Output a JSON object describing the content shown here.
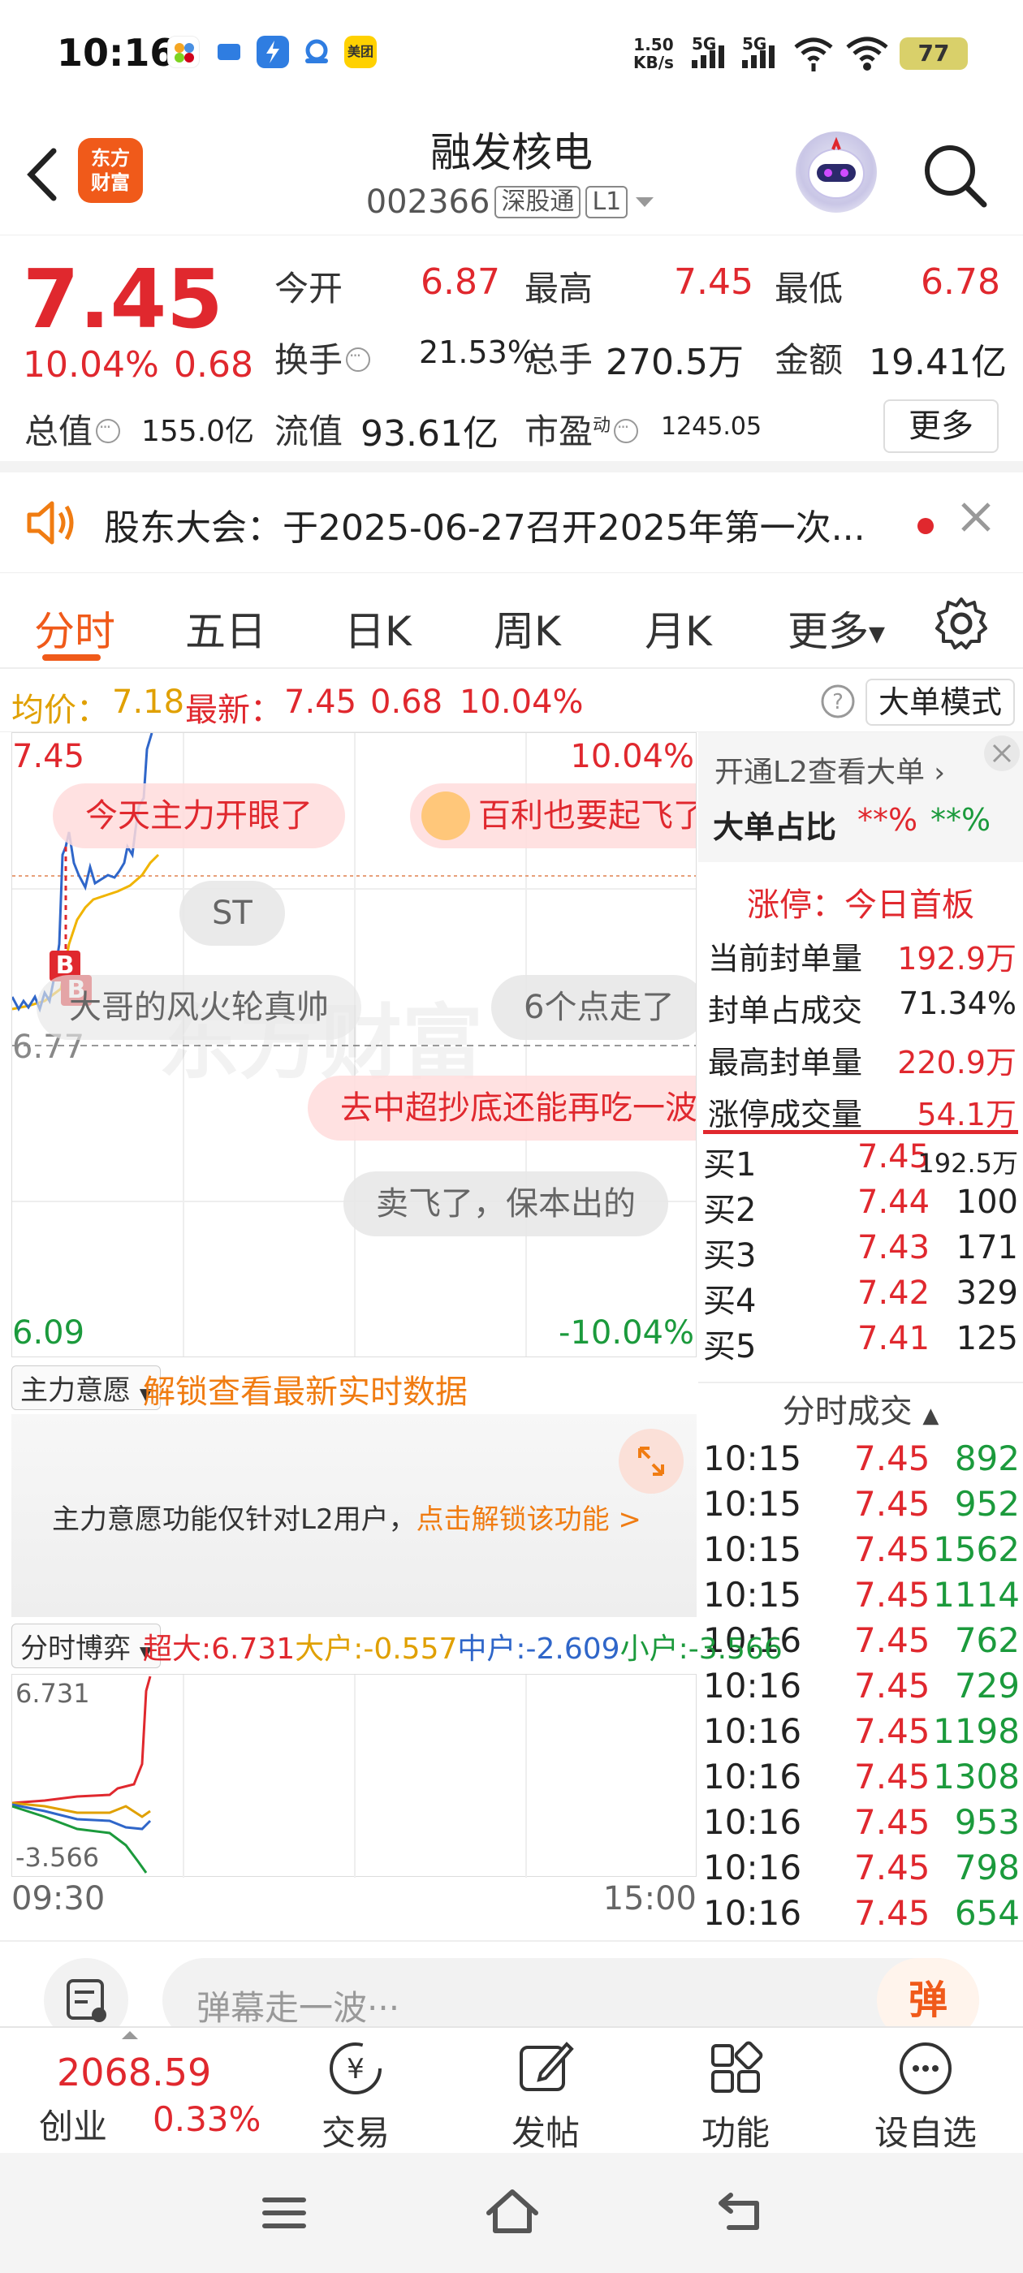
{
  "status_bar": {
    "time": "10:16",
    "net_speed_value": "1.50",
    "net_speed_unit": "KB/s",
    "sig1": "5G",
    "sig2": "5G",
    "battery": "77",
    "app_icons": [
      "wallet-app-icon",
      "messaging-app-icon",
      "flash-app-icon",
      "cloud-app-icon",
      "meituan-app-icon"
    ],
    "meituan_label": "美团"
  },
  "header": {
    "logo_line1": "东方",
    "logo_line2": "财富",
    "stock_name": "融发核电",
    "stock_code": "002366",
    "tag_sz": "深股通",
    "tag_level": "L1"
  },
  "quote": {
    "price": "7.45",
    "change_pct": "10.04%",
    "change_amt": "0.68",
    "open_label": "今开",
    "open": "6.87",
    "high_label": "最高",
    "high": "7.45",
    "low_label": "最低",
    "low": "6.78",
    "turnover_label": "换手",
    "turnover": "21.53%",
    "volume_label": "总手",
    "volume": "270.5万",
    "amount_label": "金额",
    "amount": "19.41亿",
    "mktcap_label": "总值",
    "mktcap": "155.0亿",
    "float_label": "流值",
    "float_cap": "93.61亿",
    "pe_label": "市盈",
    "pe_sup": "动",
    "pe": "1245.05",
    "more": "更多"
  },
  "notice": {
    "text": "股东大会：于2025-06-27召开2025年第一次..."
  },
  "tabs": [
    {
      "label": "分时",
      "active": true
    },
    {
      "label": "五日",
      "active": false
    },
    {
      "label": "日K",
      "active": false
    },
    {
      "label": "周K",
      "active": false
    },
    {
      "label": "月K",
      "active": false
    },
    {
      "label": "更多",
      "active": false
    }
  ],
  "avg_bar": {
    "avg_label": "均价：",
    "avg_value": "7.18",
    "latest_label": "最新：",
    "latest_value": "7.45",
    "latest_change": "0.68",
    "latest_pct": "10.04%",
    "mode_button": "大单模式"
  },
  "chart": {
    "top_price": "7.45",
    "top_pct": "10.04%",
    "mid_price": "6.77",
    "bottom_price": "6.09",
    "bottom_pct": "-10.04%",
    "marker_b1": "B",
    "marker_b2": "B",
    "danmu": [
      {
        "text": "今天主力开眼了",
        "style": "pink"
      },
      {
        "text": "百利也要起飞了",
        "style": "pink"
      },
      {
        "text": "ST",
        "style": "gray"
      },
      {
        "text": "大哥的风火轮真帅",
        "style": "gray"
      },
      {
        "text": "6个点走了",
        "style": "gray"
      },
      {
        "text": "去中超抄底还能再吃一波",
        "style": "pink"
      },
      {
        "text": "卖飞了，保本出的",
        "style": "gray"
      }
    ],
    "series": {
      "time_label_start": "09:30",
      "time_label_end": "15:00"
    }
  },
  "right_panel": {
    "l2_link": "开通L2查看大单",
    "big_order_label": "大单占比",
    "big_order_buy": "**%",
    "big_order_sell": "**%",
    "limit_up_title": "涨停：今日首板",
    "seal_rows": [
      {
        "label": "当前封单量",
        "value": "192.9万"
      },
      {
        "label": "封单占成交",
        "value": "71.34%"
      },
      {
        "label": "最高封单量",
        "value": "220.9万"
      },
      {
        "label": "涨停成交量",
        "value": "54.1万"
      }
    ],
    "order_book": [
      {
        "label": "买1",
        "price": "7.45",
        "vol": "192.5万"
      },
      {
        "label": "买2",
        "price": "7.44",
        "vol": "100"
      },
      {
        "label": "买3",
        "price": "7.43",
        "vol": "171"
      },
      {
        "label": "买4",
        "price": "7.42",
        "vol": "329"
      },
      {
        "label": "买5",
        "price": "7.41",
        "vol": "125"
      }
    ],
    "ticks_title": "分时成交",
    "ticks": [
      {
        "time": "10:15",
        "price": "7.45",
        "vol": "892"
      },
      {
        "time": "10:15",
        "price": "7.45",
        "vol": "952"
      },
      {
        "time": "10:15",
        "price": "7.45",
        "vol": "1562"
      },
      {
        "time": "10:15",
        "price": "7.45",
        "vol": "1114"
      },
      {
        "time": "10:16",
        "price": "7.45",
        "vol": "762"
      },
      {
        "time": "10:16",
        "price": "7.45",
        "vol": "729"
      },
      {
        "time": "10:16",
        "price": "7.45",
        "vol": "1198"
      },
      {
        "time": "10:16",
        "price": "7.45",
        "vol": "1308"
      },
      {
        "time": "10:16",
        "price": "7.45",
        "vol": "953"
      },
      {
        "time": "10:16",
        "price": "7.45",
        "vol": "798"
      },
      {
        "time": "10:16",
        "price": "7.45",
        "vol": "654"
      }
    ]
  },
  "main_intent": {
    "dropdown": "主力意愿",
    "unlock_title": "解锁查看最新实时数据",
    "lock_text": "主力意愿功能仅针对L2用户，",
    "lock_link": "点击解锁该功能 >"
  },
  "game": {
    "dropdown": "分时博弈",
    "super": "超大:6.731",
    "big": "大户:-0.557",
    "mid": "中户:-2.609",
    "small": "小户:-3.566",
    "top_val": "6.731",
    "bottom_val": "-3.566"
  },
  "danmu_input": {
    "placeholder": "弹幕走一波···",
    "send_label": "弹"
  },
  "bottom_nav": {
    "index_value": "2068.59",
    "index_name": "创业",
    "index_pct": "0.33%",
    "trade": "交易",
    "post": "发帖",
    "features": "功能",
    "watchlist": "设自选"
  },
  "colors": {
    "up": "#e0282e",
    "down": "#1b9a3c",
    "brand": "#f05a1a",
    "avg_line": "#f0b400"
  }
}
